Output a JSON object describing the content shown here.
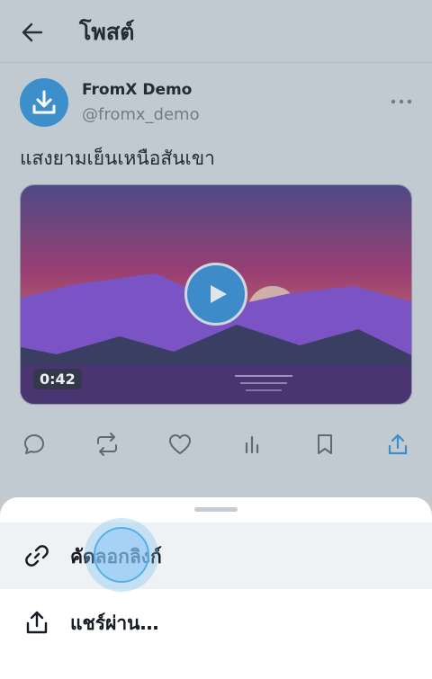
{
  "header": {
    "title": "โพสต์"
  },
  "post": {
    "author_name": "FromX Demo",
    "author_handle": "@fromx_demo",
    "text": "แสงยามเย็นเหนือสันเขา",
    "video_duration": "0:42"
  },
  "icons": {
    "back": "arrow-left-icon",
    "avatar": "download-icon",
    "more": "more-horizontal-icon",
    "play": "play-icon",
    "reply": "reply-icon",
    "repost": "repost-icon",
    "like": "heart-icon",
    "views": "views-icon",
    "bookmark": "bookmark-icon",
    "share": "share-icon",
    "copy_link": "link-icon",
    "share_via": "share-icon"
  },
  "colors": {
    "accent": "#3d8fcc",
    "background": "#c1c9d1",
    "sheet": "#ffffff"
  },
  "share_sheet": {
    "items": [
      {
        "label": "คัดลอกลิงก์"
      },
      {
        "label": "แชร์ผ่าน…"
      }
    ]
  }
}
